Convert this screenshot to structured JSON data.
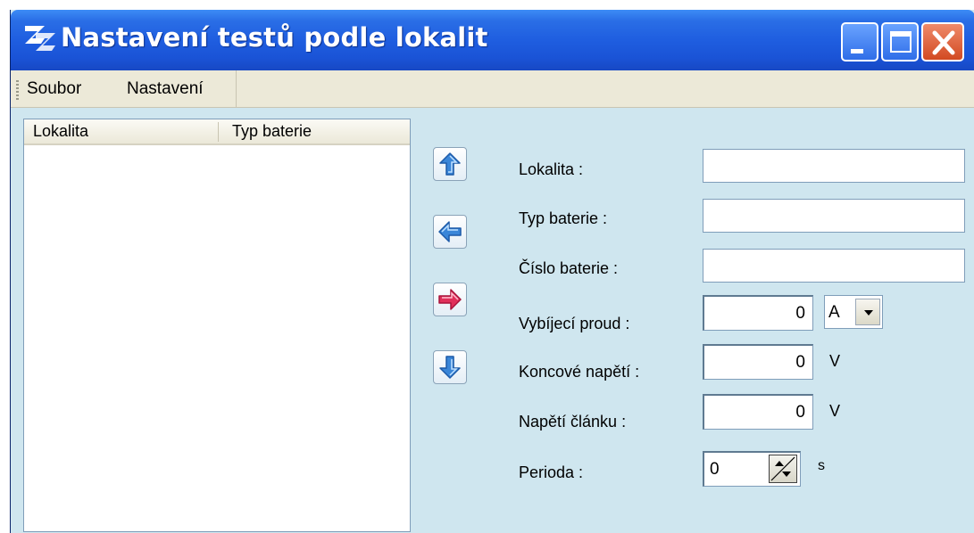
{
  "window": {
    "title": "Nastavení testů podle lokalit",
    "logo_icon": "zz-app-logo"
  },
  "titlebar_buttons": {
    "minimize_icon": "minimize-icon",
    "maximize_icon": "maximize-icon",
    "close_icon": "close-icon"
  },
  "menu": {
    "items": [
      {
        "label": "Soubor"
      },
      {
        "label": "Nastavení"
      }
    ]
  },
  "list": {
    "columns": [
      {
        "label": "Lokalita"
      },
      {
        "label": "Typ baterie"
      }
    ],
    "rows": []
  },
  "arrows": [
    {
      "icon": "arrow-up-icon",
      "color": "#3a86d8"
    },
    {
      "icon": "arrow-left-icon",
      "color": "#3a86d8"
    },
    {
      "icon": "arrow-right-icon",
      "color": "#e0305a"
    },
    {
      "icon": "arrow-down-icon",
      "color": "#3a86d8"
    }
  ],
  "form": {
    "lokalita": {
      "label": "Lokalita :",
      "value": ""
    },
    "typ_baterie": {
      "label": "Typ baterie :",
      "value": ""
    },
    "cislo_baterie": {
      "label": "Číslo baterie :",
      "value": ""
    },
    "vybijeci_proud": {
      "label": "Vybíjecí proud :",
      "value": "0",
      "unit": "A"
    },
    "koncove_napeti": {
      "label": "Koncové napětí :",
      "value": "0",
      "unit": "V"
    },
    "napeti_clanku": {
      "label": "Napětí článku :",
      "value": "0",
      "unit": "V"
    },
    "perioda": {
      "label": "Perioda :",
      "value": "0",
      "unit": "s"
    }
  },
  "colors": {
    "titlebar": "#1f5ee0",
    "client_background": "#cfe6ef",
    "menubar": "#ece9d8",
    "close_button": "#d24a22"
  }
}
